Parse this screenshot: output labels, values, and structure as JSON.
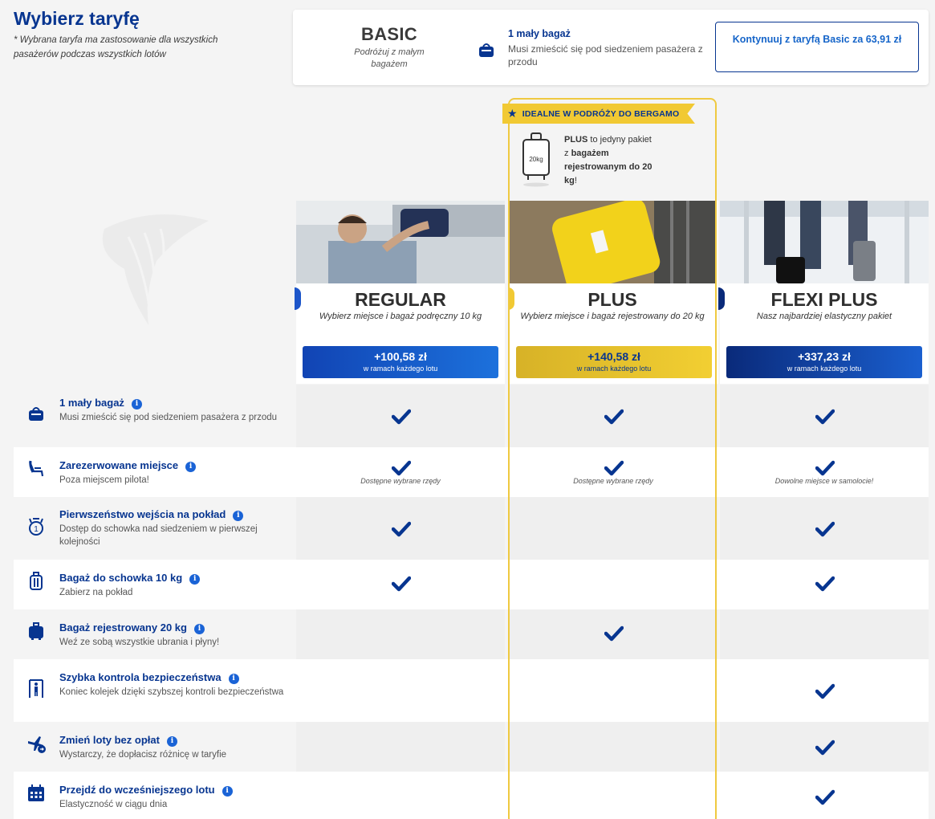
{
  "header": {
    "title": "Wybierz taryfę",
    "subtitle": "* Wybrana taryfa ma zastosowanie dla wszystkich pasażerów podczas wszystkich lotów"
  },
  "basic": {
    "name": "BASIC",
    "description": "Podróżuj z małym bagażem",
    "feature_title": "1 mały bagaż",
    "feature_desc": "Musi zmieścić się pod siedzeniem pasażera z przodu",
    "continue_label": "Kontynuuj z taryfą Basic za 63,91 zł"
  },
  "plus_promo": {
    "ribbon": "IDEALNE W PODRÓŻY DO BERGAMO",
    "bag_label": "20kg",
    "text_html_parts": [
      "PLUS",
      " to jedyny pakiet z ",
      "bagażem rejestrowanym do 20 kg",
      "!"
    ]
  },
  "fares": [
    {
      "name": "REGULAR",
      "description": "Wybierz miejsce i bagaż podręczny 10 kg",
      "price": "+100,58 zł",
      "price_sub": "w ramach każdego lotu",
      "accent": "#1c55c9"
    },
    {
      "name": "PLUS",
      "description": "Wybierz miejsce i bagaż rejestrowany do 20 kg",
      "price": "+140,58 zł",
      "price_sub": "w ramach każdego lotu",
      "accent": "#f1c933"
    },
    {
      "name": "FLEXI PLUS",
      "description": "Nasz najbardziej elastyczny pakiet",
      "price": "+337,23 zł",
      "price_sub": "w ramach każdego lotu",
      "accent": "#0a2a7a"
    }
  ],
  "features": [
    {
      "title": "1 mały bagaż",
      "desc": "Musi zmieścić się pod siedzeniem pasażera z przodu",
      "icon": "small-bag-icon",
      "checks": [
        true,
        true,
        true
      ],
      "notes": [
        "",
        "",
        ""
      ]
    },
    {
      "title": "Zarezerwowane miejsce",
      "desc": "Poza miejscem pilota!",
      "icon": "seat-icon",
      "checks": [
        true,
        true,
        true
      ],
      "notes": [
        "Dostępne wybrane rzędy",
        "Dostępne wybrane rzędy",
        "Dowolne miejsce w samolocie!"
      ]
    },
    {
      "title": "Pierwszeństwo wejścia na pokład",
      "desc": "Dostęp do schowka nad siedzeniem w pierwszej kolejności",
      "icon": "priority-icon",
      "checks": [
        true,
        false,
        true
      ],
      "notes": [
        "",
        "",
        ""
      ]
    },
    {
      "title": "Bagaż do schowka 10 kg",
      "desc": "Zabierz na pokład",
      "icon": "cabin-bag-icon",
      "checks": [
        true,
        false,
        true
      ],
      "notes": [
        "",
        "",
        ""
      ]
    },
    {
      "title": "Bagaż rejestrowany 20 kg",
      "desc": "Weź ze sobą wszystkie ubrania i płyny!",
      "icon": "checked-bag-icon",
      "checks": [
        false,
        true,
        false
      ],
      "notes": [
        "",
        "",
        ""
      ]
    },
    {
      "title": "Szybka kontrola bezpieczeństwa",
      "desc": "Koniec kolejek dzięki szybszej kontroli bezpieczeństwa",
      "icon": "security-gate-icon",
      "checks": [
        false,
        false,
        true
      ],
      "notes": [
        "",
        "",
        ""
      ]
    },
    {
      "title": "Zmień loty bez opłat",
      "desc": "Wystarczy, że dopłacisz różnicę w taryfie",
      "icon": "plane-change-icon",
      "checks": [
        false,
        false,
        true
      ],
      "notes": [
        "",
        "",
        ""
      ]
    },
    {
      "title": "Przejdź do wcześniejszego lotu",
      "desc": "Elastyczność w ciągu dnia",
      "icon": "calendar-icon",
      "checks": [
        false,
        false,
        true
      ],
      "notes": [
        "",
        "",
        ""
      ]
    }
  ],
  "colors": {
    "brand_navy": "#073590",
    "link_blue": "#1665c9",
    "plus_yellow": "#f1c933",
    "info_blue": "#1a63d6"
  }
}
